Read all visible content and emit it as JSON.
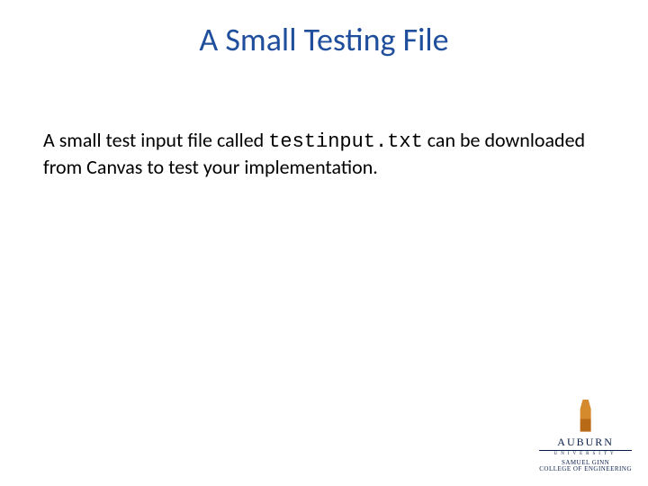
{
  "slide": {
    "title": "A Small Testing File",
    "body_prefix": "A small test input file called ",
    "body_code": "testinput.txt",
    "body_suffix": " can be downloaded from Canvas to test your implementation."
  },
  "logo": {
    "name": "AUBURN",
    "sub": "UNIVERSITY",
    "college_line1": "SAMUEL GINN",
    "college_line2": "COLLEGE OF ENGINEERING"
  }
}
